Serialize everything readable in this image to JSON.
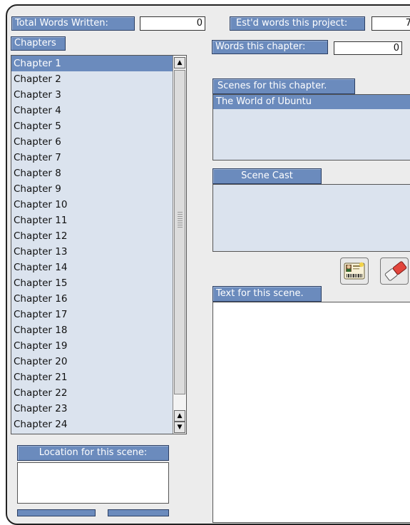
{
  "header": {
    "total_words_label": "Total Words Written:",
    "total_words_value": "0",
    "est_words_label": "Est'd words this project:",
    "est_words_value": "7",
    "chapter_words_label": "Words this chapter:",
    "chapter_words_value": "0"
  },
  "chapters": {
    "label": "Chapters",
    "items": [
      "Chapter 1",
      "Chapter 2",
      "Chapter 3",
      "Chapter 4",
      "Chapter 5",
      "Chapter 6",
      "Chapter 7",
      "Chapter 8",
      "Chapter 9",
      "Chapter 10",
      "Chapter 11",
      "Chapter 12",
      "Chapter 13",
      "Chapter 14",
      "Chapter 15",
      "Chapter 16",
      "Chapter 17",
      "Chapter 18",
      "Chapter 19",
      "Chapter 20",
      "Chapter 21",
      "Chapter 22",
      "Chapter 23",
      "Chapter 24"
    ],
    "selected": "Chapter 1"
  },
  "scenes": {
    "label": "Scenes for this chapter.",
    "items": [
      "The World of Ubuntu"
    ]
  },
  "cast": {
    "label": "Scene Cast"
  },
  "text": {
    "label": "Text for this scene."
  },
  "location": {
    "label": "Location for this scene:"
  },
  "icons": {
    "contact_card": "contact-card-icon",
    "eraser": "eraser-icon"
  },
  "colors": {
    "label_bg": "#6b8bbd",
    "list_bg": "#dbe3ee",
    "selection": "#6b8bbd"
  }
}
